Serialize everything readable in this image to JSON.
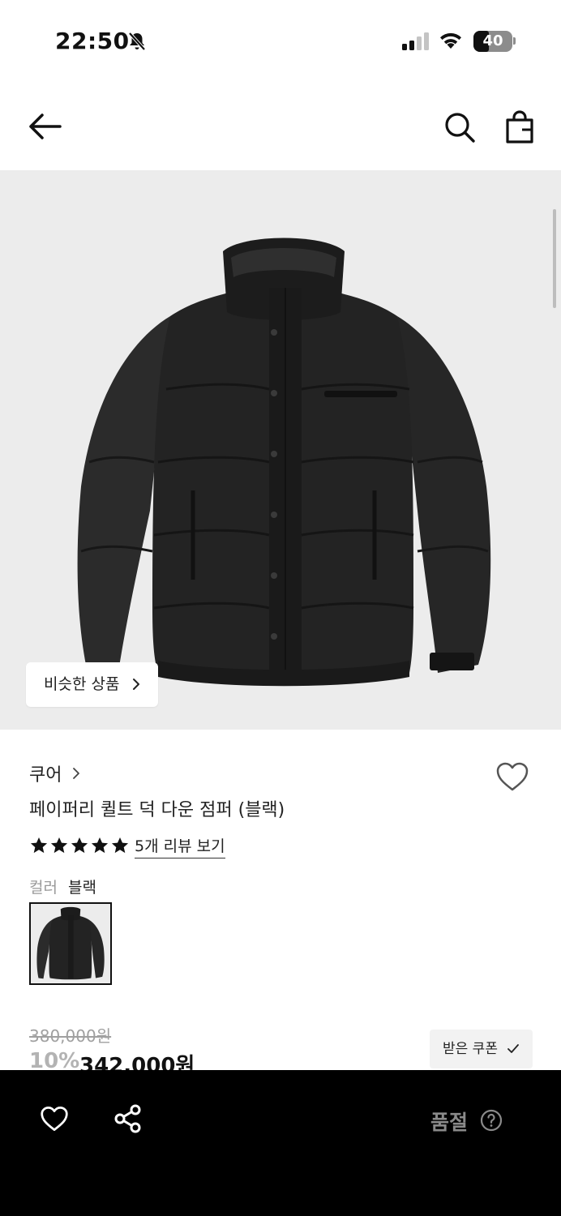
{
  "status_bar": {
    "time": "22:50",
    "battery_level": "40",
    "icons": [
      "bell-slash-icon",
      "cellular-signal-icon",
      "wifi-icon",
      "battery-icon"
    ]
  },
  "nav": {
    "icons": [
      "back-arrow-icon",
      "search-icon",
      "shopping-bag-icon"
    ]
  },
  "hero": {
    "similar_products_label": "비슷한 상품",
    "image_subject": "black quilted puffer jacket"
  },
  "product": {
    "brand": "쿠어",
    "name": "페이퍼리 퀼트 덕 다운 점퍼 (블랙)",
    "rating_stars": 5,
    "review_link": "5개 리뷰 보기",
    "color_label": "컬러",
    "color_value": "블랙"
  },
  "price": {
    "original": "380,000원",
    "discount": "10%",
    "final": "342,000원",
    "coupon_label": "받은 쿠폰"
  },
  "bottom_bar": {
    "status": "품절",
    "icons": [
      "heart-outline-icon",
      "share-icon",
      "help-circle-icon"
    ]
  },
  "colors": {
    "hero_background": "#ececec",
    "bottom_bar": "#000000",
    "soldout_text": "#8a8a8a"
  }
}
